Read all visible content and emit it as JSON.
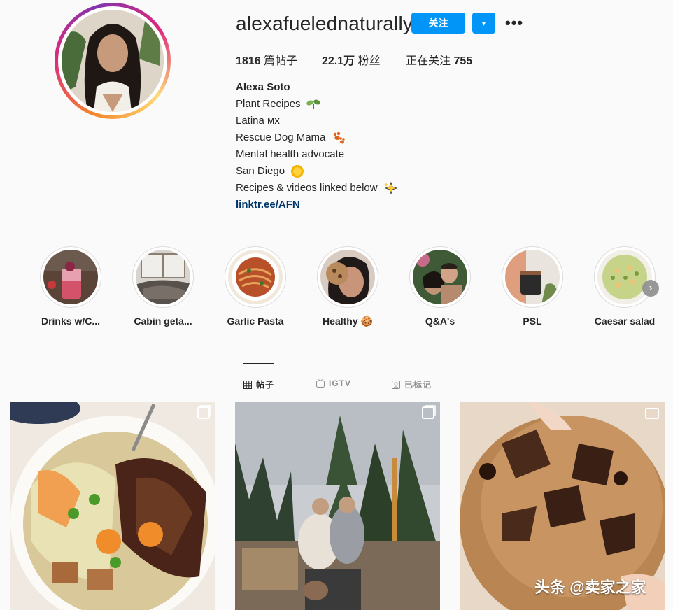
{
  "profile": {
    "username": "alexafuelednaturally",
    "follow_label": "关注",
    "dropdown_icon": "▾",
    "more_icon": "•••"
  },
  "stats": {
    "posts_value": "1816",
    "posts_label": "篇帖子",
    "followers_value": "22.1万",
    "followers_label": "粉丝",
    "following_label": "正在关注",
    "following_value": "755"
  },
  "bio": {
    "name": "Alexa Soto",
    "line1": "Plant Recipes",
    "line1_emoji": "seedling-icon",
    "line2": "Latina ᴍx",
    "line3": "Rescue Dog Mama",
    "line3_emoji": "paw-prints-icon",
    "line4": "Mental health advocate",
    "line5": "San Diego",
    "line5_emoji": "sun-icon",
    "line6": "Recipes & videos linked below",
    "line6_emoji": "sparkles-icon",
    "link": "linktr.ee/AFN"
  },
  "highlights": [
    {
      "label": "Drinks w/C..."
    },
    {
      "label": "Cabin geta..."
    },
    {
      "label": "Garlic Pasta"
    },
    {
      "label": "Healthy 🍪"
    },
    {
      "label": "Q&A's"
    },
    {
      "label": "PSL"
    },
    {
      "label": "Caesar salad"
    }
  ],
  "tabs": {
    "posts": "帖子",
    "igtv": "IGTV",
    "tagged": "已标记"
  },
  "watermark": "头条 @卖家之家",
  "colors": {
    "accent": "#0095f6",
    "link": "#00376b",
    "text": "#262626",
    "muted": "#8e8e8e"
  }
}
